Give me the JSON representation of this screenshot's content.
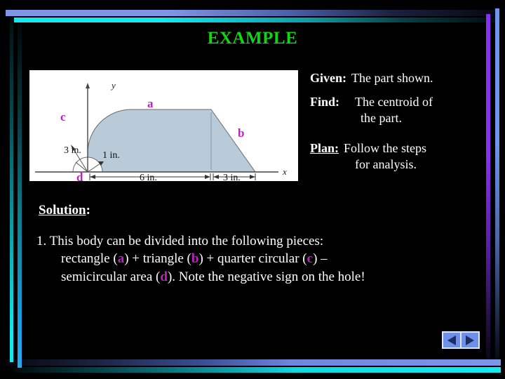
{
  "slide": {
    "title": "EXAMPLE",
    "background_color": "#000000",
    "title_color": "#10d810",
    "accent_colors": {
      "blue_bar": "#7f95e8",
      "cyan_bar": "#12eaf0",
      "violet_rule": "#8a2ff5",
      "magenta_label": "#c020c0"
    }
  },
  "given_block": {
    "given_label": "Given:",
    "given_value": "The part shown.",
    "find_label": "Find:",
    "find_value": "The centroid of",
    "find_value_2": "the part.",
    "plan_label": "Plan:",
    "plan_value": "Follow the steps",
    "plan_value_2": "for analysis."
  },
  "solution": {
    "heading_word": "Solution",
    "heading_colon": ":",
    "step_number": "1.",
    "step_line1": "This body can be divided into the following pieces:",
    "step_line2_pre": "rectangle (",
    "step_line2_a": "a",
    "step_line2_mid1": ") +  triangle (",
    "step_line2_b": "b",
    "step_line2_mid2": ")  + quarter circular (",
    "step_line2_c": "c",
    "step_line2_post": ") –",
    "step_line3_pre": "semicircular area (",
    "step_line3_d": "d",
    "step_line3_post": ").  Note the negative sign on the hole!"
  },
  "figure": {
    "fill_color": "#b9cbd9",
    "stroke_color": "#555555",
    "axis_x_label": "x",
    "axis_y_label": "y",
    "part_labels": {
      "a": "a",
      "b": "b",
      "c": "c",
      "d": "d"
    },
    "dimensions": {
      "radius_outer": "3 in.",
      "radius_inner": "1 in.",
      "base_rect": "6 in.",
      "base_tri": "3 in."
    }
  },
  "nav": {
    "prev_label": "previous-slide",
    "next_label": "next-slide"
  }
}
